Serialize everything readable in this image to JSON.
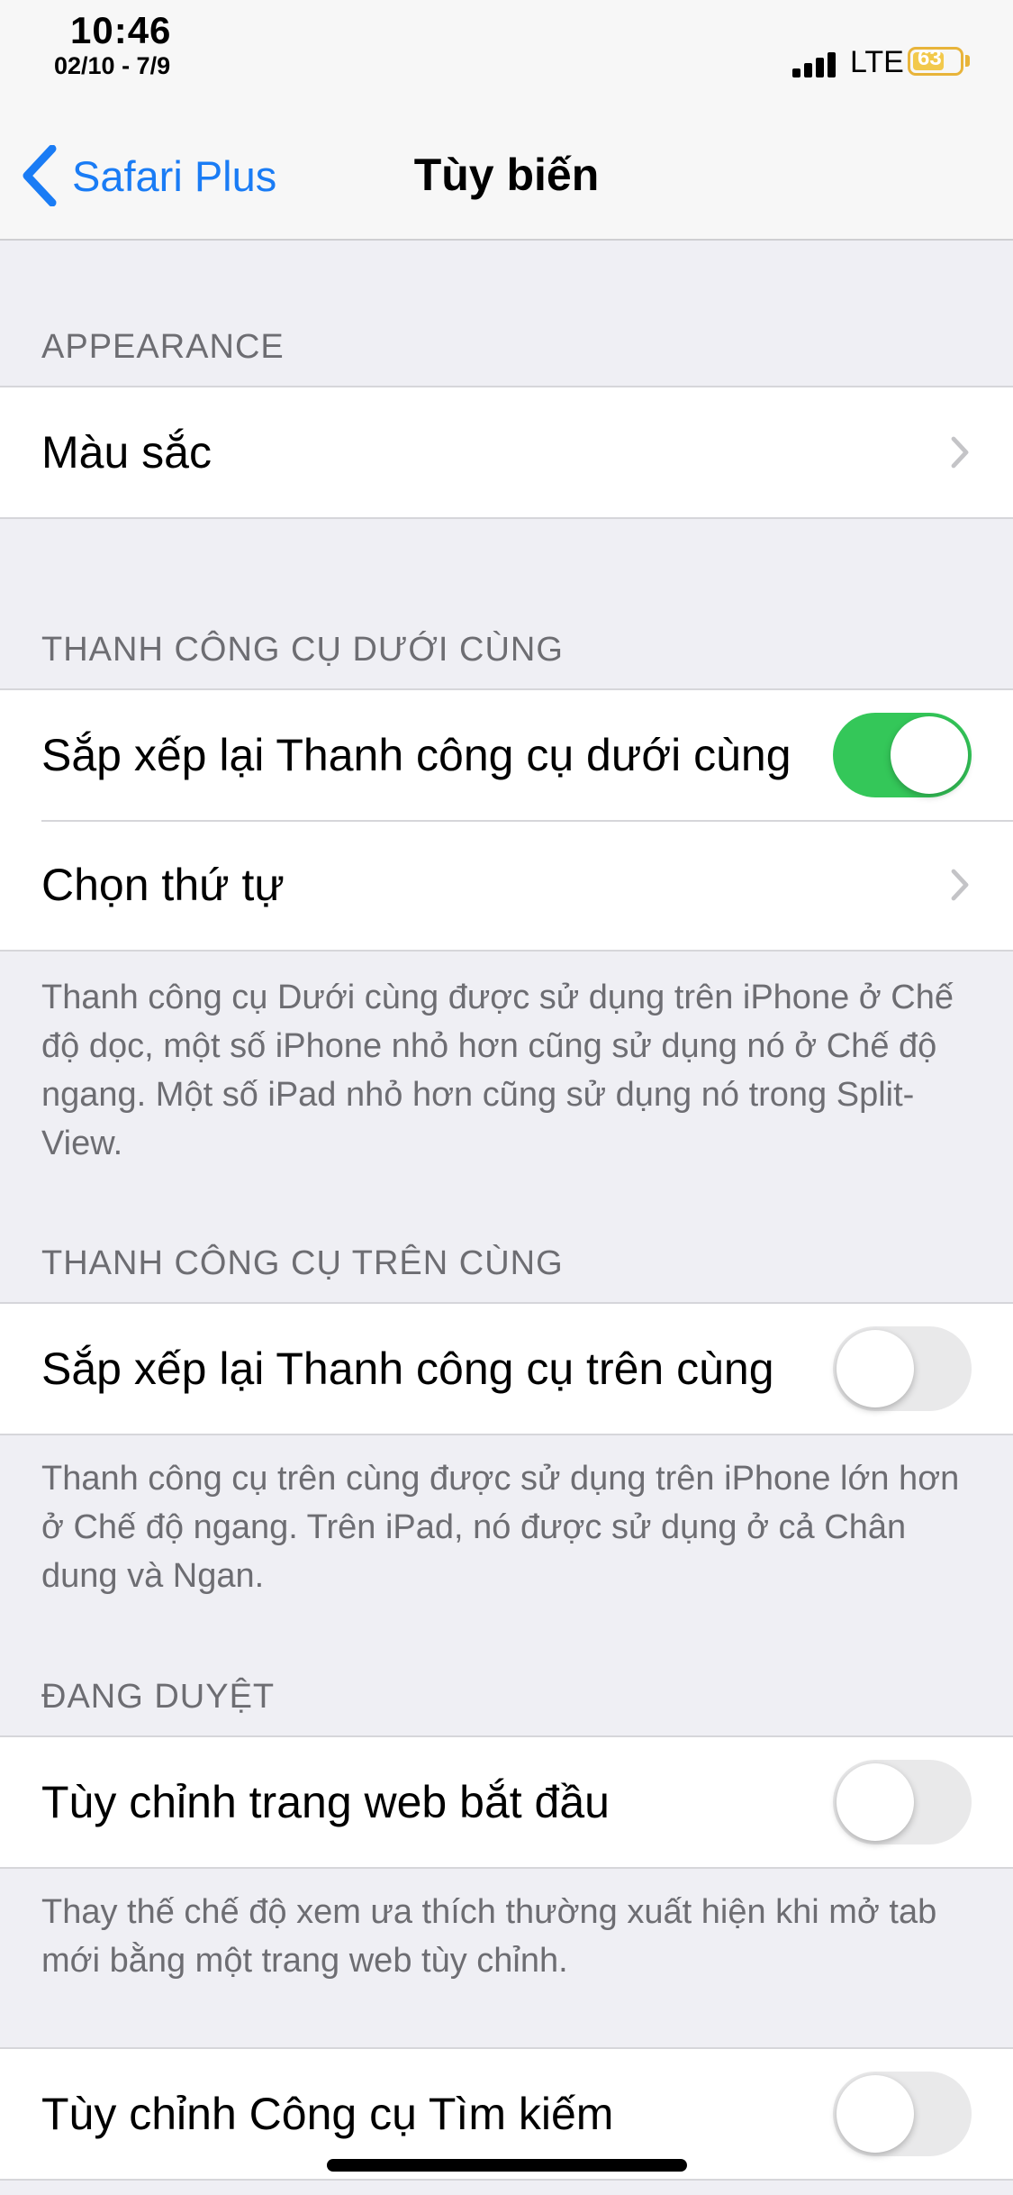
{
  "status_bar": {
    "time": "10:46",
    "date": "02/10 - 7/9",
    "network": "LTE",
    "battery": "63"
  },
  "nav": {
    "back_label": "Safari Plus",
    "title": "Tùy biến"
  },
  "sections": {
    "appearance": {
      "header": "APPEARANCE",
      "items": [
        {
          "label": "Màu sắc"
        }
      ]
    },
    "bottom_toolbar": {
      "header": "THANH CÔNG CỤ DƯỚI CÙNG",
      "items": [
        {
          "label": "Sắp xếp lại Thanh công cụ dưới cùng",
          "toggle_on": true
        },
        {
          "label": "Chọn thứ tự"
        }
      ],
      "footer": "Thanh công cụ Dưới cùng được sử dụng trên iPhone ở Chế độ dọc, một số iPhone nhỏ hơn cũng sử dụng nó ở Chế độ ngang. Một số iPad nhỏ hơn cũng sử dụng nó trong Split-View."
    },
    "top_toolbar": {
      "header": "THANH CÔNG CỤ TRÊN CÙNG",
      "items": [
        {
          "label": "Sắp xếp lại Thanh công cụ trên cùng",
          "toggle_on": false
        }
      ],
      "footer": "Thanh công cụ trên cùng được sử dụng trên iPhone lớn hơn ở Chế độ ngang. Trên iPad, nó được sử dụng ở cả Chân dung và Ngan."
    },
    "browsing": {
      "header": "ĐANG DUYỆT",
      "items": [
        {
          "label": "Tùy chỉnh trang web bắt đầu",
          "toggle_on": false
        }
      ],
      "footer": "Thay thế chế độ xem ưa thích thường xuất hiện khi mở tab mới bằng một trang web tùy chỉnh."
    },
    "search": {
      "items": [
        {
          "label": "Tùy chỉnh Công cụ Tìm kiếm",
          "toggle_on": false
        }
      ]
    }
  },
  "colors": {
    "accent": "#1a7cf5",
    "toggle_on": "#34c759",
    "battery": "#f2c94c"
  }
}
